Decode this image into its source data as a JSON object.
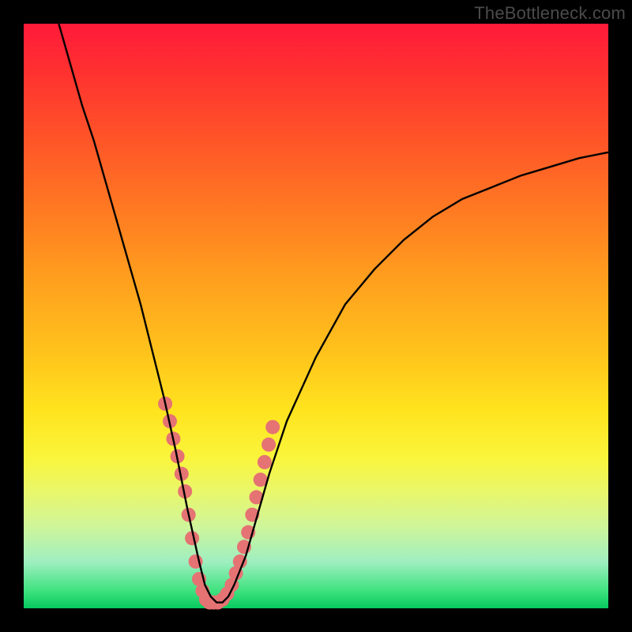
{
  "watermark": "TheBottleneck.com",
  "chart_data": {
    "type": "line",
    "title": "",
    "xlabel": "",
    "ylabel": "",
    "xlim": [
      0,
      100
    ],
    "ylim": [
      0,
      100
    ],
    "series": [
      {
        "name": "curve",
        "color": "#000000",
        "x": [
          6,
          8,
          10,
          12,
          14,
          16,
          18,
          20,
          22,
          24,
          26,
          28,
          30,
          31,
          32,
          33,
          34,
          35,
          36,
          38,
          40,
          42,
          45,
          50,
          55,
          60,
          65,
          70,
          75,
          80,
          85,
          90,
          95,
          100
        ],
        "y": [
          100,
          93,
          86,
          80,
          73,
          66,
          59,
          52,
          44,
          36,
          27,
          17,
          8,
          4,
          2,
          1,
          1,
          2,
          4,
          9,
          16,
          23,
          32,
          43,
          52,
          58,
          63,
          67,
          70,
          72,
          74,
          75.5,
          77,
          78
        ]
      },
      {
        "name": "dots",
        "color": "#e57373",
        "x": [
          24.2,
          25.0,
          25.6,
          26.3,
          27.0,
          27.6,
          28.2,
          28.8,
          29.4,
          30.0,
          30.6,
          31.2,
          31.8,
          32.5,
          33.2,
          34.0,
          34.8,
          35.6,
          36.3,
          37.0,
          37.7,
          38.4,
          39.1,
          39.8,
          40.5,
          41.2,
          41.9,
          42.6
        ],
        "y": [
          35,
          32,
          29,
          26,
          23,
          20,
          16,
          12,
          8,
          5,
          3,
          1.5,
          1,
          1,
          1,
          1.5,
          2.5,
          4,
          6,
          8,
          10.5,
          13,
          16,
          19,
          22,
          25,
          28,
          31
        ],
        "radius": 9
      }
    ]
  }
}
